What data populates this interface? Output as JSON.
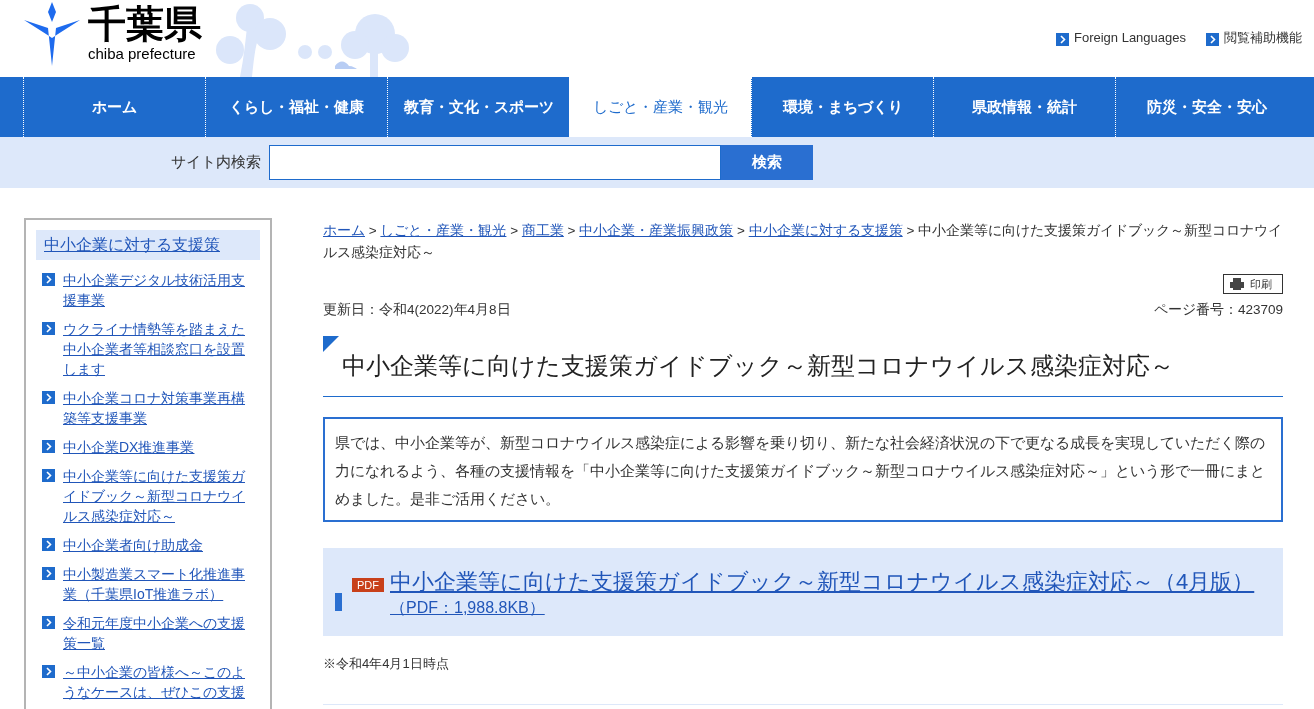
{
  "header": {
    "logo_title": "千葉県",
    "logo_subtitle": "chiba prefecture",
    "links": [
      "Foreign Languages",
      "閲覧補助機能"
    ]
  },
  "nav": [
    {
      "label": "ホーム",
      "selected": false
    },
    {
      "label": "くらし・福祉・健康",
      "selected": false
    },
    {
      "label": "教育・文化・スポーツ",
      "selected": false
    },
    {
      "label": "しごと・産業・観光",
      "selected": true
    },
    {
      "label": "環境・まちづくり",
      "selected": false
    },
    {
      "label": "県政情報・統計",
      "selected": false
    },
    {
      "label": "防災・安全・安心",
      "selected": false
    }
  ],
  "search": {
    "label": "サイト内検索",
    "button": "検索"
  },
  "sidebar": {
    "title": "中小企業に対する支援策",
    "items": [
      "中小企業デジタル技術活用支援事業",
      "ウクライナ情勢等を踏まえた中小企業者等相談窓口を設置します",
      "中小企業コロナ対策事業再構築等支援事業",
      "中小企業DX推進事業",
      "中小企業等に向けた支援策ガイドブック～新型コロナウイルス感染症対応～",
      "中小企業者向け助成金",
      "中小製造業スマート化推進事業（千葉県IoT推進ラボ）",
      "令和元年度中小企業への支援策一覧",
      "～中小企業の皆様へ～このようなケースは、ぜひこの支援"
    ]
  },
  "breadcrumb": {
    "separator": ">",
    "links": [
      "ホーム",
      "しごと・産業・観光",
      "商工業",
      "中小企業・産業振興政策",
      "中小企業に対する支援策"
    ],
    "current": "中小企業等に向けた支援策ガイドブック～新型コロナウイルス感染症対応～"
  },
  "print_button": "印刷",
  "updated": "更新日：令和4(2022)年4月8日",
  "page_number": "ページ番号：423709",
  "title": "中小企業等に向けた支援策ガイドブック～新型コロナウイルス感染症対応～",
  "intro": "県では、中小企業等が、新型コロナウイルス感染症による影響を乗り切り、新たな社会経済状況の下で更なる成長を実現していただく際の力になれるよう、各種の支援情報を「中小企業等に向けた支援策ガイドブック～新型コロナウイルス感染症対応～」という形で一冊にまとめました。是非ご活用ください。",
  "download": {
    "badge": "PDF",
    "link": "中小企業等に向けた支援策ガイドブック～新型コロナウイルス感染症対応～（4月版）",
    "size": "（PDF：1,988.8KB）"
  },
  "note": "※令和4年4月1日時点"
}
